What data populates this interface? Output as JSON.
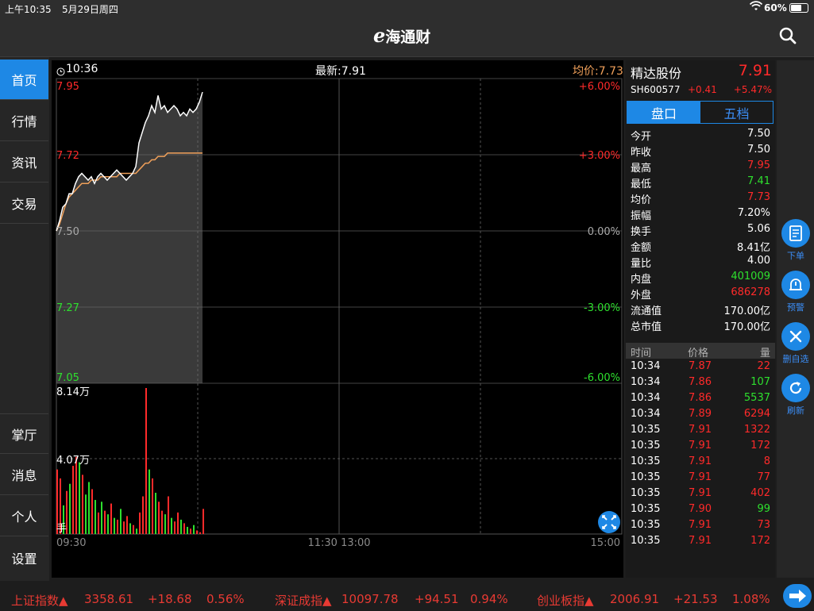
{
  "status": {
    "time": "上午10:35",
    "date": "5月29日周四",
    "battery": "60%"
  },
  "app": {
    "logo_e": "e",
    "logo_text": "海通财"
  },
  "sidebar": {
    "top": [
      {
        "label": "首页",
        "active": true
      },
      {
        "label": "行情"
      },
      {
        "label": "资讯"
      },
      {
        "label": "交易"
      }
    ],
    "bottom": [
      {
        "label": "掌厅"
      },
      {
        "label": "消息"
      },
      {
        "label": "个人"
      },
      {
        "label": "设置"
      }
    ]
  },
  "chart_header": {
    "clock": "10:36",
    "latest": "最新:7.91",
    "avg": "均价:7.73"
  },
  "chart_data": {
    "type": "line",
    "price_axis": [
      {
        "label": "7.95",
        "pct": "+6.00%",
        "dir": "up"
      },
      {
        "label": "7.72",
        "pct": "+3.00%",
        "dir": "up"
      },
      {
        "label": "7.50",
        "pct": "0.00%",
        "dir": "flat"
      },
      {
        "label": "7.27",
        "pct": "-3.00%",
        "dir": "down"
      },
      {
        "label": "7.05",
        "pct": "-6.00%",
        "dir": "down"
      }
    ],
    "ylim": [
      7.05,
      7.95
    ],
    "volume_axis": [
      "8.14万",
      "4.07万"
    ],
    "volume_unit": "手",
    "x_ticks": [
      "09:30",
      "11:30 13:00",
      "15:00"
    ],
    "series": [
      {
        "values": [
          7.5,
          7.53,
          7.57,
          7.58,
          7.61,
          7.61,
          7.64,
          7.66,
          7.67,
          7.66,
          7.65,
          7.66,
          7.64,
          7.66,
          7.67,
          7.66,
          7.65,
          7.66,
          7.67,
          7.68,
          7.67,
          7.66,
          7.65,
          7.66,
          7.67,
          7.69,
          7.76,
          7.79,
          7.82,
          7.84,
          7.87,
          7.85,
          7.9,
          7.86,
          7.87,
          7.85,
          7.86,
          7.87,
          7.86,
          7.84,
          7.85,
          7.84,
          7.86,
          7.85,
          7.86,
          7.88,
          7.91
        ]
      },
      {
        "values": [
          7.5,
          7.52,
          7.55,
          7.58,
          7.6,
          7.61,
          7.62,
          7.63,
          7.64,
          7.64,
          7.64,
          7.65,
          7.65,
          7.65,
          7.66,
          7.66,
          7.66,
          7.66,
          7.66,
          7.66,
          7.67,
          7.67,
          7.67,
          7.67,
          7.67,
          7.67,
          7.68,
          7.69,
          7.7,
          7.7,
          7.71,
          7.71,
          7.72,
          7.72,
          7.72,
          7.73,
          7.73,
          7.73,
          7.73,
          7.73,
          7.73,
          7.73,
          7.73,
          7.73,
          7.73,
          7.73,
          7.73
        ]
      }
    ],
    "volume_max": 81400,
    "volumes": [
      36000,
      31000,
      16000,
      24000,
      28000,
      38000,
      43000,
      40000,
      33000,
      22000,
      29000,
      25000,
      19000,
      12000,
      18000,
      13000,
      11000,
      17000,
      9000,
      8000,
      14000,
      7000,
      10000,
      6000,
      5000,
      3000,
      12000,
      21000,
      81400,
      36000,
      31000,
      23000,
      18000,
      13000,
      11000,
      21000,
      9000,
      7000,
      12000,
      8000,
      6000,
      4000,
      3000,
      5000,
      2000,
      1000,
      14000
    ],
    "volume_up": [
      true,
      true,
      false,
      true,
      false,
      true,
      true,
      false,
      true,
      false,
      false,
      true,
      false,
      true,
      false,
      true,
      false,
      true,
      false,
      true,
      false,
      true,
      true,
      false,
      true,
      false,
      true,
      true,
      true,
      false,
      true,
      false,
      true,
      true,
      false,
      true,
      false,
      true,
      true,
      false,
      true,
      false,
      true,
      false,
      true,
      true,
      true
    ]
  },
  "stock": {
    "name": "精达股份",
    "price": "7.91",
    "code": "SH600577",
    "change": "+0.41",
    "pct": "+5.47%"
  },
  "tabs": [
    {
      "label": "盘口",
      "active": true
    },
    {
      "label": "五档"
    }
  ],
  "stats": [
    {
      "k": "今开",
      "v": "7.50",
      "c": "w"
    },
    {
      "k": "昨收",
      "v": "7.50",
      "c": "w"
    },
    {
      "k": "最高",
      "v": "7.95",
      "c": "r"
    },
    {
      "k": "最低",
      "v": "7.41",
      "c": "g"
    },
    {
      "k": "均价",
      "v": "7.73",
      "c": "r"
    },
    {
      "k": "振幅",
      "v": "7.20%",
      "c": "w"
    },
    {
      "k": "换手",
      "v": "5.06",
      "c": "w"
    },
    {
      "k": "金额",
      "v": "8.41亿",
      "c": "w"
    },
    {
      "k": "量比",
      "v": "4.00",
      "c": "w"
    },
    {
      "k": "内盘",
      "v": "401009",
      "c": "g"
    },
    {
      "k": "外盘",
      "v": "686278",
      "c": "r"
    },
    {
      "k": "流通值",
      "v": "170.00亿",
      "c": "w"
    },
    {
      "k": "总市值",
      "v": "170.00亿",
      "c": "w"
    }
  ],
  "trades_header": {
    "time": "时间",
    "price": "价格",
    "qty": "量"
  },
  "trades": [
    {
      "t": "10:34",
      "p": "7.87",
      "q": "22",
      "qc": "r"
    },
    {
      "t": "10:34",
      "p": "7.86",
      "q": "107",
      "qc": "g"
    },
    {
      "t": "10:34",
      "p": "7.86",
      "q": "5537",
      "qc": "g"
    },
    {
      "t": "10:34",
      "p": "7.89",
      "q": "6294",
      "qc": "r"
    },
    {
      "t": "10:35",
      "p": "7.91",
      "q": "1322",
      "qc": "r"
    },
    {
      "t": "10:35",
      "p": "7.91",
      "q": "172",
      "qc": "r"
    },
    {
      "t": "10:35",
      "p": "7.91",
      "q": "8",
      "qc": "r"
    },
    {
      "t": "10:35",
      "p": "7.91",
      "q": "77",
      "qc": "r"
    },
    {
      "t": "10:35",
      "p": "7.91",
      "q": "402",
      "qc": "r"
    },
    {
      "t": "10:35",
      "p": "7.90",
      "q": "99",
      "qc": "g"
    },
    {
      "t": "10:35",
      "p": "7.91",
      "q": "73",
      "qc": "r"
    },
    {
      "t": "10:35",
      "p": "7.91",
      "q": "172",
      "qc": "r"
    }
  ],
  "actions": [
    {
      "label": "下单",
      "icon": "order-icon"
    },
    {
      "label": "预警",
      "icon": "alert-bell-icon"
    },
    {
      "label": "删自选",
      "icon": "close-icon"
    },
    {
      "label": "刷新",
      "icon": "refresh-icon"
    }
  ],
  "ticker": [
    {
      "name": "上证指数▲",
      "value": "3358.61",
      "chg": "+18.68",
      "pct": "0.56%"
    },
    {
      "name": "深证成指▲",
      "value": "10097.78",
      "chg": "+94.51",
      "pct": "0.94%"
    },
    {
      "name": "创业板指▲",
      "value": "2006.91",
      "chg": "+21.53",
      "pct": "1.08%"
    }
  ],
  "colors": {
    "up": "#ff2a2a",
    "down": "#2ee02e",
    "accent": "#1e88e5",
    "avg_line": "#f0a05a"
  }
}
